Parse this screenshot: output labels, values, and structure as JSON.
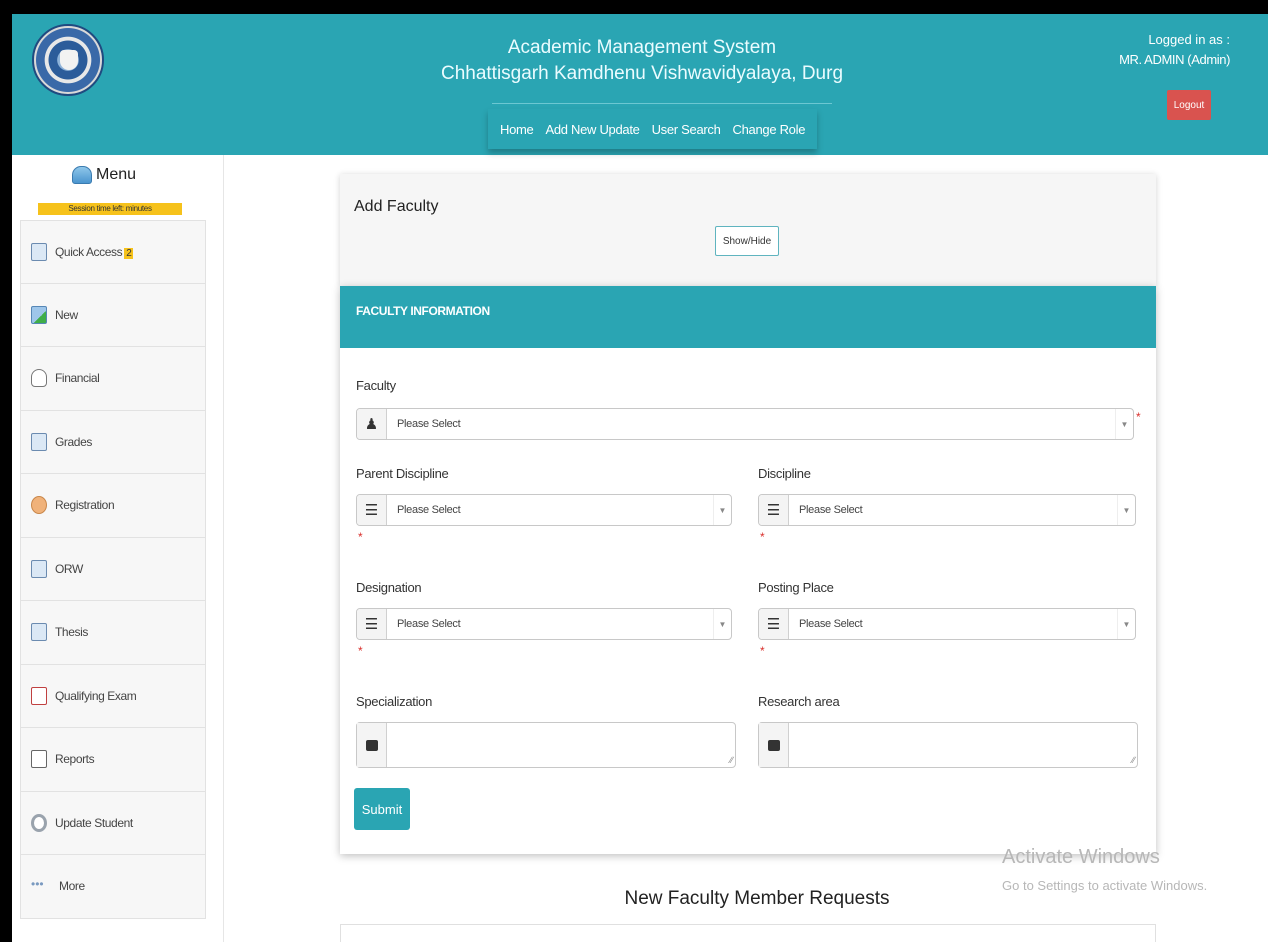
{
  "header": {
    "title": "Academic Management System",
    "subtitle": "Chhattisgarh Kamdhenu Vishwavidyalaya, Durg",
    "nav": [
      "Home",
      "Add New Update",
      "User Search",
      "Change Role"
    ],
    "logged_in_label": "Logged in as :",
    "logged_in_user": "MR. ADMIN (Admin)",
    "logout_label": "Logout",
    "accent_color": "#2aa5b3",
    "logout_color": "#d9534f"
  },
  "sidebar": {
    "menu_title": "Menu",
    "session_text": "Session time left: minutes",
    "items": [
      {
        "label": "Quick Access",
        "badge": "2",
        "icon": "quick-access-icon"
      },
      {
        "label": "New",
        "icon": "new-doc-icon"
      },
      {
        "label": "Financial",
        "icon": "financial-icon"
      },
      {
        "label": "Grades",
        "icon": "grades-icon"
      },
      {
        "label": "Registration",
        "icon": "registration-icon"
      },
      {
        "label": "ORW",
        "icon": "orw-icon"
      },
      {
        "label": "Thesis",
        "icon": "thesis-icon"
      },
      {
        "label": "Qualifying Exam",
        "icon": "qualifying-exam-icon"
      },
      {
        "label": "Reports",
        "icon": "reports-icon"
      },
      {
        "label": "Update Student",
        "icon": "update-student-icon"
      },
      {
        "label": "More",
        "icon": "more-icon"
      }
    ]
  },
  "add_faculty": {
    "title": "Add Faculty",
    "show_hide_label": "Show/Hide"
  },
  "form": {
    "header": "FACULTY INFORMATION",
    "faculty": {
      "label": "Faculty",
      "value": "Please Select"
    },
    "parent_discipline": {
      "label": "Parent Discipline",
      "value": "Please Select"
    },
    "discipline": {
      "label": "Discipline",
      "value": "Please Select"
    },
    "designation": {
      "label": "Designation",
      "value": "Please Select"
    },
    "posting_place": {
      "label": "Posting Place",
      "value": "Please Select"
    },
    "specialization": {
      "label": "Specialization",
      "value": ""
    },
    "research_area": {
      "label": "Research area",
      "value": ""
    },
    "required_mark": "*",
    "submit_label": "Submit"
  },
  "requests": {
    "title": "New Faculty Member Requests"
  },
  "watermark": {
    "line1": "Activate Windows",
    "line2": "Go to Settings to activate Windows."
  }
}
